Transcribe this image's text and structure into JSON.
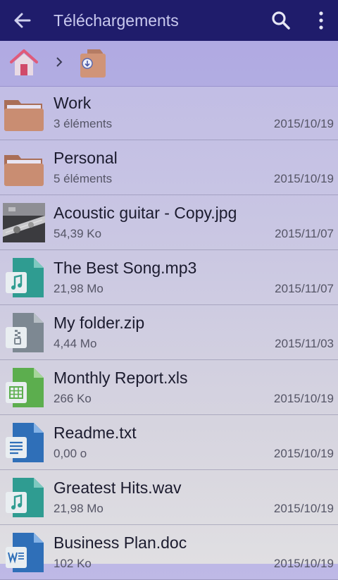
{
  "appbar": {
    "title": "Téléchargements",
    "back_icon": "arrow-left-icon",
    "search_icon": "search-icon",
    "more_icon": "more-vert-icon"
  },
  "breadcrumb": {
    "home_icon": "home-icon",
    "separator_icon": "chevron-right-icon",
    "current_icon": "download-folder-icon"
  },
  "colors": {
    "appbar_bg": "#1f1c6b",
    "folder": "#c48c72",
    "audio": "#2f9c91",
    "archive": "#7d8892",
    "spreadsheet": "#5cae4e",
    "document": "#2f6fb8"
  },
  "files": [
    {
      "name": "Work",
      "meta": "3 éléments",
      "date": "2015/10/19",
      "icon": "folder-icon"
    },
    {
      "name": "Personal",
      "meta": "5 éléments",
      "date": "2015/10/19",
      "icon": "folder-icon"
    },
    {
      "name": "Acoustic guitar - Copy.jpg",
      "meta": "54,39 Ko",
      "date": "2015/11/07",
      "icon": "image-thumbnail-icon"
    },
    {
      "name": "The Best Song.mp3",
      "meta": "21,98 Mo",
      "date": "2015/11/07",
      "icon": "audio-file-icon"
    },
    {
      "name": "My folder.zip",
      "meta": "4,44 Mo",
      "date": "2015/11/03",
      "icon": "zip-file-icon"
    },
    {
      "name": "Monthly Report.xls",
      "meta": "266 Ko",
      "date": "2015/10/19",
      "icon": "spreadsheet-file-icon"
    },
    {
      "name": "Readme.txt",
      "meta": "0,00 o",
      "date": "2015/10/19",
      "icon": "text-file-icon"
    },
    {
      "name": "Greatest Hits.wav",
      "meta": "21,98 Mo",
      "date": "2015/10/19",
      "icon": "audio-file-icon"
    },
    {
      "name": "Business Plan.doc",
      "meta": "102 Ko",
      "date": "2015/10/19",
      "icon": "word-file-icon"
    }
  ]
}
